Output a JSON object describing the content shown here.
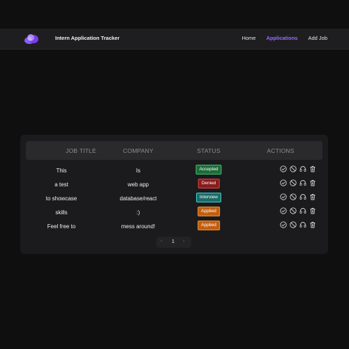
{
  "colors": {
    "accent": "#9b6bff",
    "background": "#0f0f10"
  },
  "header": {
    "title": "Intern Application Tracker",
    "logo_icon": "cloud-logo-icon",
    "nav": [
      {
        "label": "Home",
        "active": false
      },
      {
        "label": "Applications",
        "active": true
      },
      {
        "label": "Add Job",
        "active": false
      }
    ]
  },
  "table": {
    "columns": [
      "JOB TITLE",
      "COMPANY",
      "STATUS",
      "ACTIONS"
    ],
    "rows": [
      {
        "job_title": "This",
        "company": "Is",
        "status": "Accepted"
      },
      {
        "job_title": "a test",
        "company": "web app",
        "status": "Denied"
      },
      {
        "job_title": "to showcase",
        "company": "database/react",
        "status": "Interview"
      },
      {
        "job_title": "skills",
        "company": ":)",
        "status": "Applied"
      },
      {
        "job_title": "Feel free to",
        "company": "mess around!",
        "status": "Applied"
      }
    ],
    "status_colors": {
      "Accepted": {
        "bg": "#1e6b3a",
        "border": "#3ec46d"
      },
      "Denied": {
        "bg": "#8a1c1c",
        "border": "#d84545"
      },
      "Interview": {
        "bg": "#1c6b68",
        "border": "#3fd0c9"
      },
      "Applied": {
        "bg": "#c25e10",
        "border": "#f0922e"
      }
    },
    "action_icons": [
      "check-circle-icon",
      "ban-icon",
      "headset-icon",
      "trash-icon"
    ]
  },
  "pagination": {
    "prev": "‹",
    "current": "1",
    "next": "›"
  }
}
